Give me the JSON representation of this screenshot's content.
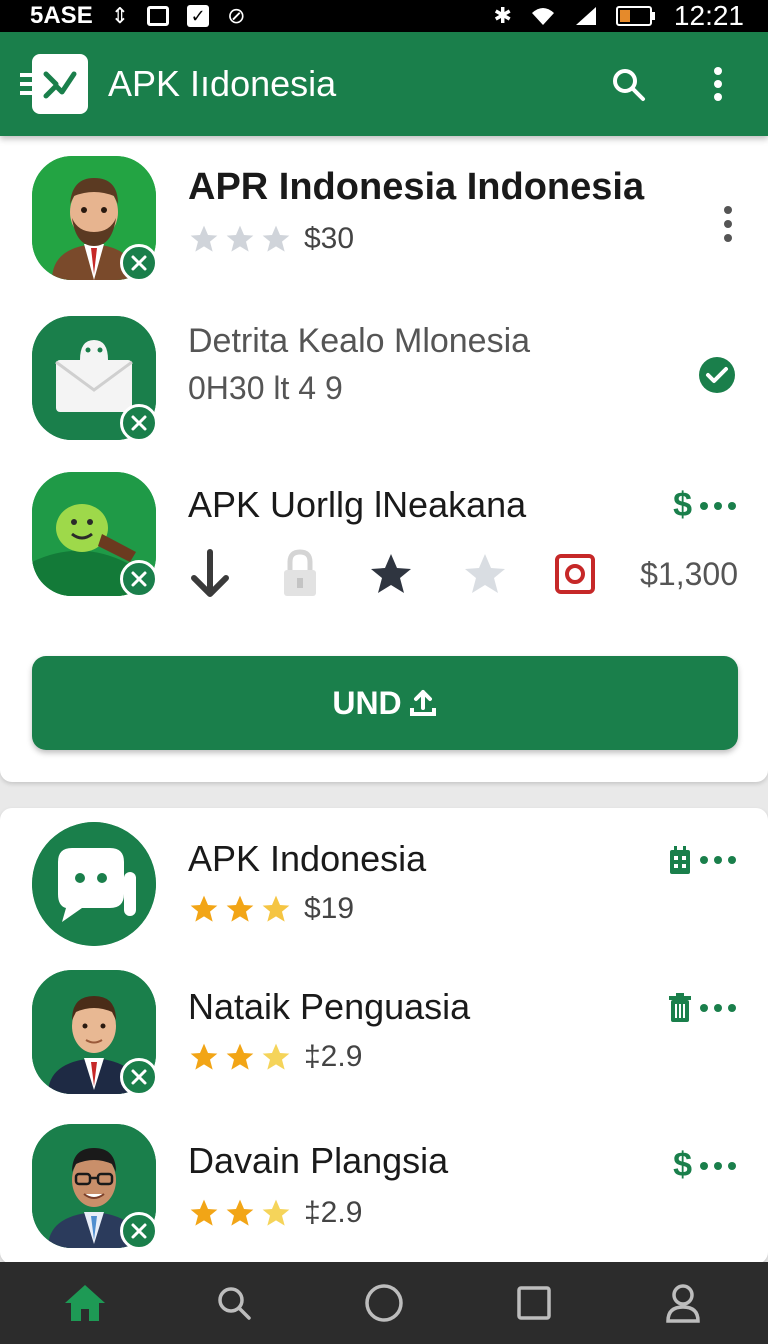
{
  "status_bar": {
    "carrier": "5ASE",
    "time": "12:21"
  },
  "app_bar": {
    "title": "APK Iıdonesia",
    "icons": [
      "menu-icon",
      "app-logo",
      "search-icon",
      "more-vertical-icon"
    ]
  },
  "featured": {
    "items": [
      {
        "title": "APR Indonesia Indonesia",
        "rating_text": "$30",
        "stars_filled": 3,
        "star_color": "#d0d4da"
      },
      {
        "title": "Detrita  Kealo Mlonesia",
        "subtitle": "0H30 lt  4 9",
        "status": "check-circle-icon"
      },
      {
        "title": "APK Uorllg lNeakana",
        "price_right": "$",
        "price_label": "$1,300",
        "action_icons": [
          "arrow-down-icon",
          "lock-icon",
          "star-dark-icon",
          "star-light-icon",
          "camera-icon"
        ]
      }
    ],
    "button_label": "UND"
  },
  "list": {
    "items": [
      {
        "title": "APK Indonesia",
        "rating_text": "$19",
        "trailing": "calendar-icon",
        "star_color": "#f2a516"
      },
      {
        "title": "Nataik Penguasia",
        "rating_text": "‡2.9",
        "trailing": "trash-icon",
        "star_color": "#f2a516"
      },
      {
        "title": "Davain Plangsia",
        "rating_text": "‡2.9",
        "trailing": "$",
        "star_color": "#f2a516"
      }
    ]
  },
  "bottom_nav": {
    "items": [
      "home-icon",
      "search-icon",
      "circle-icon",
      "square-icon",
      "profile-icon"
    ],
    "active": "home-icon"
  },
  "colors": {
    "primary": "#1a7f4b",
    "nav_bg": "#2c2c2c"
  }
}
